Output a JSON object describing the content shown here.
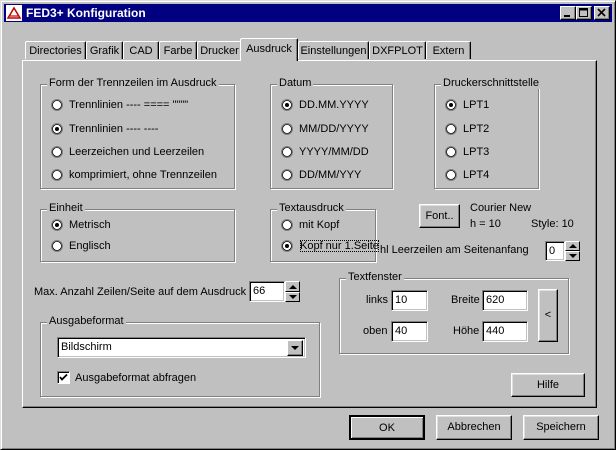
{
  "window": {
    "title": "FED3+ Konfiguration"
  },
  "tabs": [
    {
      "label": "Directories"
    },
    {
      "label": "Grafik"
    },
    {
      "label": "CAD"
    },
    {
      "label": "Farbe"
    },
    {
      "label": "Drucker"
    },
    {
      "label": "Ausdruck",
      "active": true
    },
    {
      "label": "Einstellungen"
    },
    {
      "label": "DXFPLOT"
    },
    {
      "label": "Extern"
    }
  ],
  "trennzeilen": {
    "legend": "Form der Trennzeilen im Ausdruck",
    "options": [
      {
        "label": "Trennlinien  ---- ====  \"\"\"\"",
        "selected": false
      },
      {
        "label": "Trennlinien  ---- ----",
        "selected": true
      },
      {
        "label": "Leerzeichen und Leerzeilen",
        "selected": false
      },
      {
        "label": "komprimiert, ohne Trennzeilen",
        "selected": false
      }
    ]
  },
  "datum": {
    "legend": "Datum",
    "options": [
      {
        "label": "DD.MM.YYYY",
        "selected": true
      },
      {
        "label": "MM/DD/YYYY",
        "selected": false
      },
      {
        "label": "YYYY/MM/DD",
        "selected": false
      },
      {
        "label": "DD/MM/YYY",
        "selected": false
      }
    ]
  },
  "druckerschnittstelle": {
    "legend": "Druckerschnittstelle",
    "options": [
      {
        "label": "LPT1",
        "selected": true
      },
      {
        "label": "LPT2",
        "selected": false
      },
      {
        "label": "LPT3",
        "selected": false
      },
      {
        "label": "LPT4",
        "selected": false
      }
    ]
  },
  "einheit": {
    "legend": "Einheit",
    "options": [
      {
        "label": "Metrisch",
        "selected": true
      },
      {
        "label": "Englisch",
        "selected": false
      }
    ]
  },
  "textausdruck": {
    "legend": "Textausdruck",
    "options": [
      {
        "label": "mit Kopf",
        "selected": false
      },
      {
        "label": "Kopf nur 1.Seite",
        "selected": true
      }
    ]
  },
  "font": {
    "button_label": "Font..",
    "name": "Courier New",
    "height": "h = 10",
    "style": "Style:  10"
  },
  "leerzeilen": {
    "label": "hl Leerzeilen am Seitenanfang",
    "value": "0"
  },
  "zeilen": {
    "label": "Max. Anzahl Zeilen/Seite auf dem Ausdruck",
    "value": "66"
  },
  "textfenster": {
    "legend": "Textfenster",
    "links_label": "links",
    "links_value": "10",
    "breite_label": "Breite",
    "breite_value": "620",
    "oben_label": "oben",
    "oben_value": "40",
    "hoehe_label": "Höhe",
    "hoehe_value": "440",
    "arrow_label": "<"
  },
  "ausgabeformat": {
    "legend": "Ausgabeformat",
    "selected": "Bildschirm",
    "checkbox_label": "Ausgabeformat abfragen",
    "checked": true
  },
  "buttons": {
    "hilfe": "Hilfe",
    "ok": "OK",
    "abbrechen": "Abbrechen",
    "speichern": "Speichern"
  }
}
